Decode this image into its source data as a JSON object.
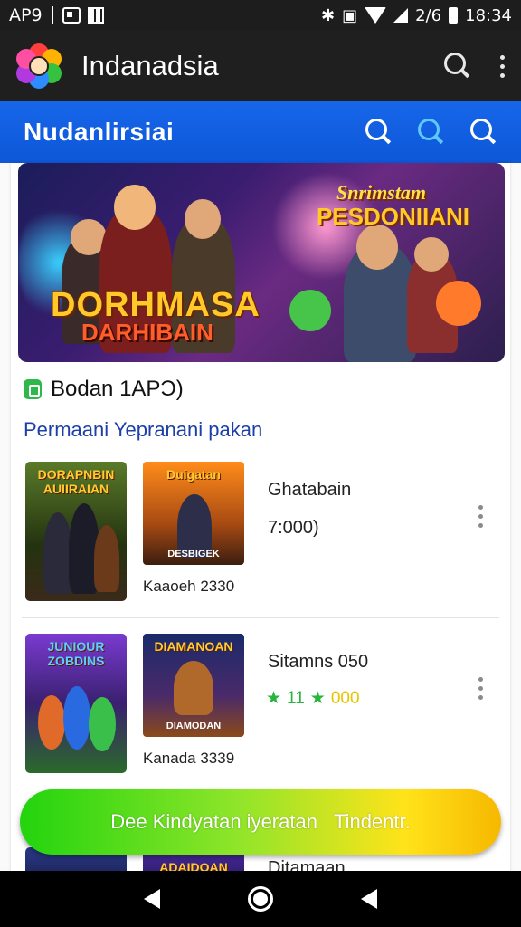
{
  "status_bar": {
    "left_text": "AP9",
    "network_label": "2/6",
    "time": "18:34"
  },
  "app_header": {
    "title": "Indanadsia"
  },
  "blue_bar": {
    "title": "Nudanlirsiai"
  },
  "hero": {
    "title": "DORHMASA",
    "subtitle": "DARHIBAIN",
    "right_line1": "Snrimstam",
    "right_line2": "PESDONIIANI"
  },
  "section": {
    "title": "Bodan 1APƆ)",
    "subtitle": "Permaani Yepranani pakan"
  },
  "items": [
    {
      "thumb1_title": "DORAPNBIN AUIIRAIAN",
      "thumb2_title": "Duigatan",
      "thumb2_bottom": "DESBIGEK",
      "caption": "Kaaoeh 2330",
      "name": "Ghatabain",
      "price": "7:000)"
    },
    {
      "thumb1_title": "JUNIOUR ZOBDINS",
      "thumb2_title": "DIAMANOAN",
      "thumb2_bottom": "DIAMODAN",
      "caption": "Kanada 3339",
      "name": "Sitamns 050",
      "rating1": "11",
      "rating2": "000"
    },
    {
      "thumb2_title": "ADAIDOAN",
      "name": "Ditamaan"
    }
  ],
  "cta": {
    "label_left": "Dee Kindyatan iyeratan",
    "label_right": "Tindentr."
  },
  "colors": {
    "header_bg": "#1f1f1f",
    "blue_bar": "#1766ea",
    "link": "#1c3fa8",
    "star_green": "#27b53c",
    "star_yellow": "#e8c400"
  }
}
